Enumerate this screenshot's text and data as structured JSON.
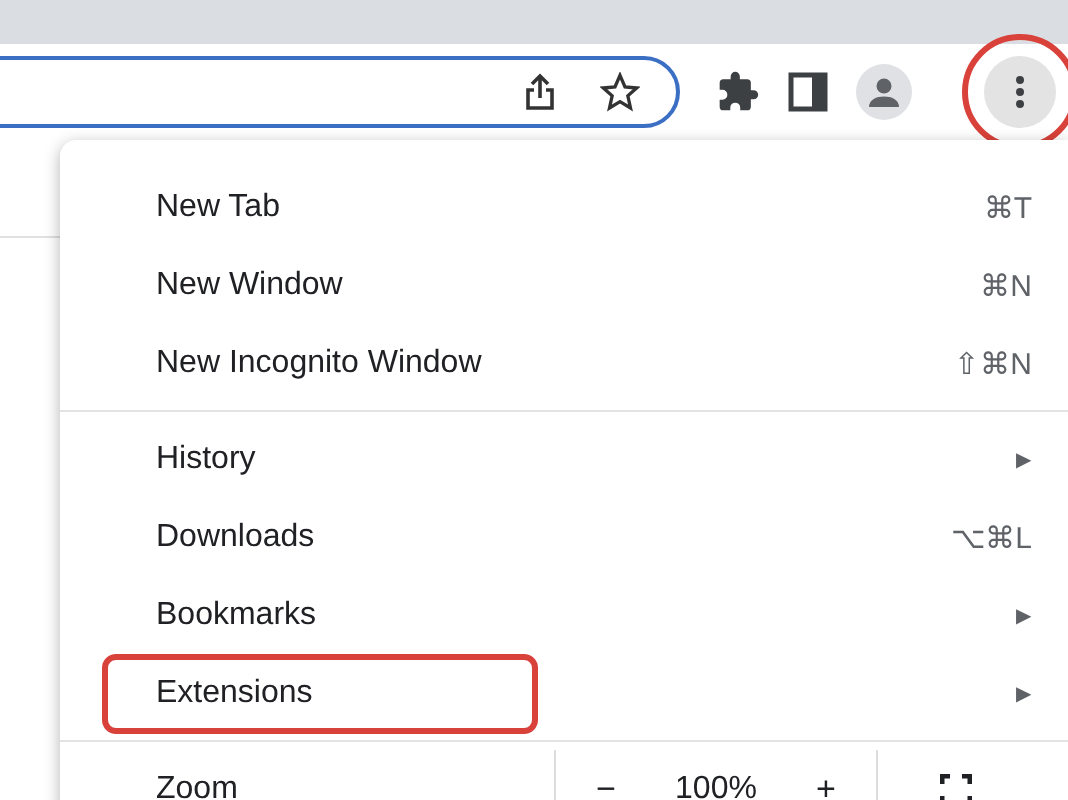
{
  "toolbar": {
    "menu_button_highlighted": true
  },
  "menu": {
    "sections": [
      [
        {
          "kind": "shortcut",
          "label": "New Tab",
          "shortcut": "⌘T",
          "highlighted": false
        },
        {
          "kind": "shortcut",
          "label": "New Window",
          "shortcut": "⌘N",
          "highlighted": false
        },
        {
          "kind": "shortcut",
          "label": "New Incognito Window",
          "shortcut": "⇧⌘N",
          "highlighted": false
        }
      ],
      [
        {
          "kind": "submenu",
          "label": "History",
          "arrow": "▶",
          "highlighted": false
        },
        {
          "kind": "shortcut",
          "label": "Downloads",
          "shortcut": "⌥⌘L",
          "highlighted": false
        },
        {
          "kind": "submenu",
          "label": "Bookmarks",
          "arrow": "▶",
          "highlighted": false
        },
        {
          "kind": "submenu",
          "label": "Extensions",
          "arrow": "▶",
          "highlighted": true
        }
      ],
      [
        {
          "kind": "zoom",
          "label": "Zoom",
          "minus": "−",
          "value": "100%",
          "plus": "+",
          "highlighted": false
        }
      ]
    ]
  }
}
